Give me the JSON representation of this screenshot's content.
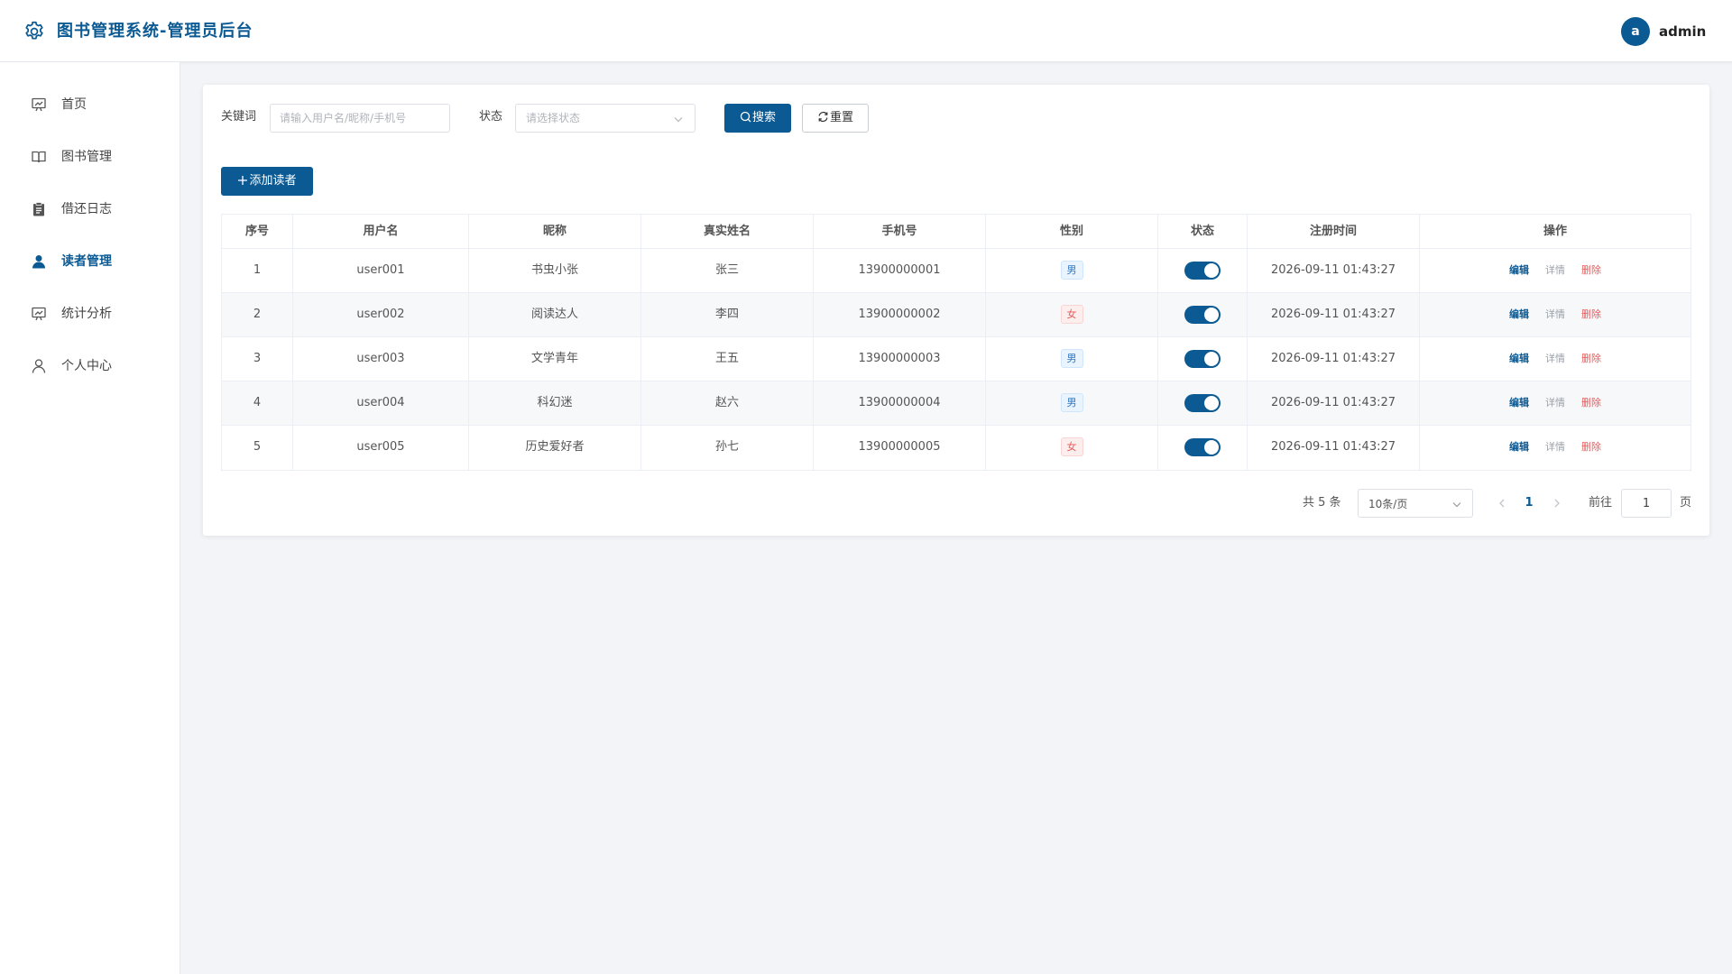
{
  "header": {
    "title": "图书管理系统-管理员后台",
    "logo_icon": "gear-icon",
    "avatar_initial": "a",
    "username": "admin"
  },
  "sidebar": {
    "items": [
      {
        "label": "首页",
        "icon": "dashboard-icon",
        "active": false
      },
      {
        "label": "图书管理",
        "icon": "book-icon",
        "active": false
      },
      {
        "label": "借还日志",
        "icon": "clipboard-icon",
        "active": false
      },
      {
        "label": "读者管理",
        "icon": "user-icon",
        "active": true
      },
      {
        "label": "统计分析",
        "icon": "presentation-icon",
        "active": false
      },
      {
        "label": "个人中心",
        "icon": "user-outline-icon",
        "active": false
      }
    ]
  },
  "filters": {
    "keyword_label": "关键词",
    "keyword_placeholder": "请输入用户名/昵称/手机号",
    "keyword_value": "",
    "status_label": "状态",
    "status_placeholder": "请选择状态",
    "search_label": "搜索",
    "reset_label": "重置"
  },
  "toolbar": {
    "add_label": "添加读者"
  },
  "table": {
    "columns": [
      "序号",
      "用户名",
      "昵称",
      "真实姓名",
      "手机号",
      "性别",
      "状态",
      "注册时间",
      "操作"
    ],
    "rows": [
      {
        "index": "1",
        "username": "user001",
        "nickname": "书虫小张",
        "realname": "张三",
        "phone": "13900000001",
        "gender": "男",
        "enabled": true,
        "registered": "2026-09-11 01:43:27"
      },
      {
        "index": "2",
        "username": "user002",
        "nickname": "阅读达人",
        "realname": "李四",
        "phone": "13900000002",
        "gender": "女",
        "enabled": true,
        "registered": "2026-09-11 01:43:27"
      },
      {
        "index": "3",
        "username": "user003",
        "nickname": "文学青年",
        "realname": "王五",
        "phone": "13900000003",
        "gender": "男",
        "enabled": true,
        "registered": "2026-09-11 01:43:27"
      },
      {
        "index": "4",
        "username": "user004",
        "nickname": "科幻迷",
        "realname": "赵六",
        "phone": "13900000004",
        "gender": "男",
        "enabled": true,
        "registered": "2026-09-11 01:43:27"
      },
      {
        "index": "5",
        "username": "user005",
        "nickname": "历史爱好者",
        "realname": "孙七",
        "phone": "13900000005",
        "gender": "女",
        "enabled": true,
        "registered": "2026-09-11 01:43:27"
      }
    ],
    "actions": {
      "edit": "编辑",
      "detail": "详情",
      "delete": "删除"
    }
  },
  "pagination": {
    "total_text": "共 5 条",
    "page_size": "10条/页",
    "current_page": "1",
    "goto_label": "前往",
    "goto_value": "1",
    "page_suffix": "页"
  },
  "colors": {
    "primary": "#0b5a93",
    "danger": "#e85a5a",
    "male_tag": "#2c79c7",
    "background": "#f2f4f7"
  }
}
